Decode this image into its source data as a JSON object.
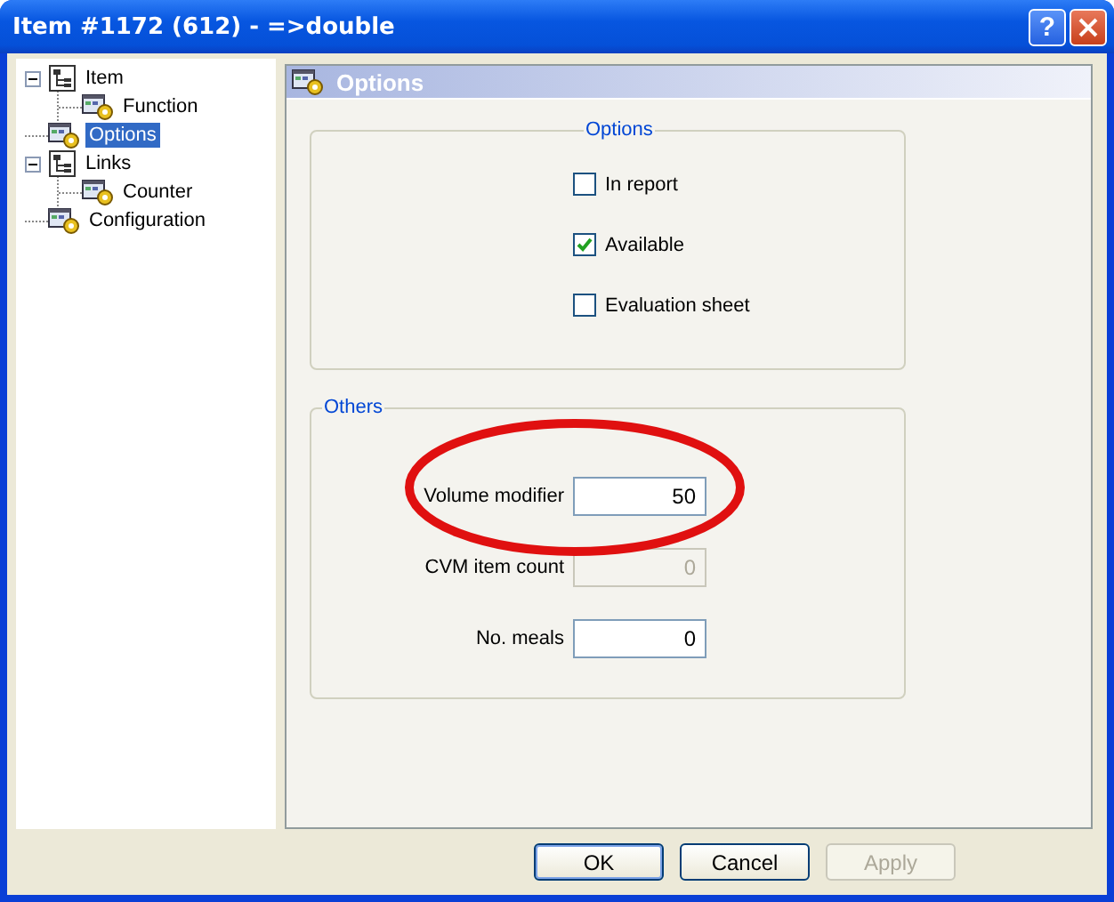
{
  "window": {
    "title": "Item #1172 (612) - =>double",
    "help_button": "?"
  },
  "tree": [
    {
      "label": "Item",
      "kind": "group",
      "expanded": true,
      "selected": false,
      "children": [
        {
          "label": "Function",
          "kind": "page",
          "selected": false
        }
      ]
    },
    {
      "label": "Options",
      "kind": "page",
      "selected": true
    },
    {
      "label": "Links",
      "kind": "group",
      "expanded": true,
      "selected": false,
      "children": [
        {
          "label": "Counter",
          "kind": "page",
          "selected": false
        }
      ]
    },
    {
      "label": "Configuration",
      "kind": "page",
      "selected": false
    }
  ],
  "panel": {
    "title": "Options",
    "options_group": {
      "title": "Options",
      "checkboxes": [
        {
          "label": "In report",
          "checked": false
        },
        {
          "label": "Available",
          "checked": true
        },
        {
          "label": "Evaluation sheet",
          "checked": false
        }
      ]
    },
    "others_group": {
      "title": "Others",
      "fields": [
        {
          "label": "Volume modifier",
          "value": "50",
          "disabled": false
        },
        {
          "label": "CVM item count",
          "value": "0",
          "disabled": true
        },
        {
          "label": "No. meals",
          "value": "0",
          "disabled": false
        }
      ]
    }
  },
  "buttons": [
    {
      "label": "OK",
      "disabled": false,
      "default": true
    },
    {
      "label": "Cancel",
      "disabled": false,
      "default": false
    },
    {
      "label": "Apply",
      "disabled": true,
      "default": false
    }
  ]
}
